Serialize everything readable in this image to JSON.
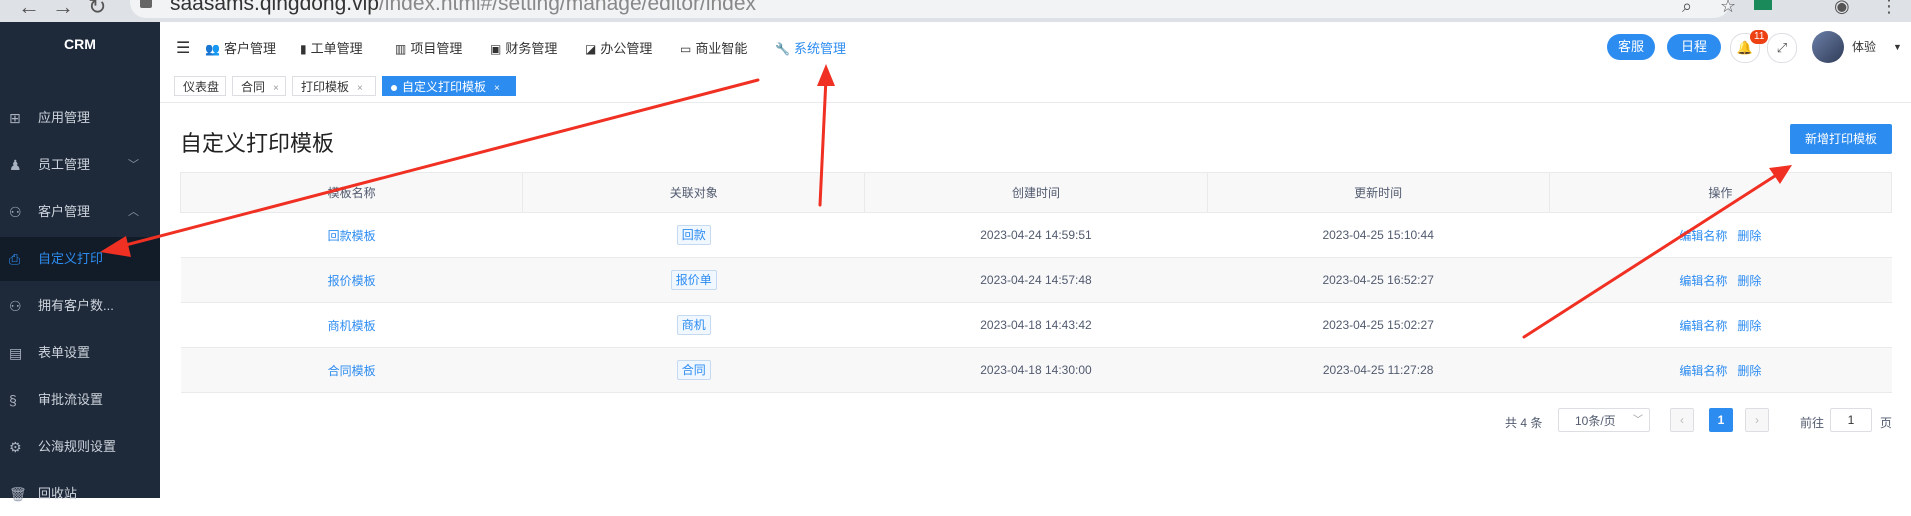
{
  "browser": {
    "url_host": "saasams.qingdong.vip",
    "url_path": "/index.html#/setting/manage/editor/index"
  },
  "sidebar": {
    "logo": "CRM",
    "items": [
      {
        "label": "应用管理",
        "icon": "apps-icon",
        "glyph": "⊞"
      },
      {
        "label": "员工管理",
        "icon": "user-icon",
        "glyph": "♟",
        "chevron": "﹀"
      },
      {
        "label": "客户管理",
        "icon": "customers-icon",
        "glyph": "⚇",
        "chevron": "︿"
      },
      {
        "label": "自定义打印",
        "icon": "print-icon",
        "glyph": "⎙",
        "active": true
      },
      {
        "label": "拥有客户数...",
        "icon": "group-icon",
        "glyph": "⚇"
      },
      {
        "label": "表单设置",
        "icon": "form-icon",
        "glyph": "▤"
      },
      {
        "label": "审批流设置",
        "icon": "flow-icon",
        "glyph": "§"
      },
      {
        "label": "公海规则设置",
        "icon": "rules-icon",
        "glyph": "⚙"
      },
      {
        "label": "回收站",
        "icon": "trash-icon",
        "glyph": "🗑"
      }
    ]
  },
  "topnav": {
    "items": [
      {
        "label": "客户管理",
        "icon": "customer-icon",
        "glyph": "👥"
      },
      {
        "label": "工单管理",
        "icon": "ticket-icon",
        "glyph": "▮"
      },
      {
        "label": "项目管理",
        "icon": "project-icon",
        "glyph": "▥"
      },
      {
        "label": "财务管理",
        "icon": "finance-icon",
        "glyph": "▣"
      },
      {
        "label": "办公管理",
        "icon": "office-icon",
        "glyph": "◪"
      },
      {
        "label": "商业智能",
        "icon": "bi-icon",
        "glyph": "▭"
      },
      {
        "label": "系统管理",
        "icon": "wrench-icon",
        "glyph": "🔧",
        "active": true
      }
    ],
    "service_label": "客服",
    "schedule_label": "日程",
    "notification_count": "11",
    "user_name": "体验"
  },
  "tabs": [
    {
      "label": "仪表盘"
    },
    {
      "label": "合同",
      "close": "×"
    },
    {
      "label": "打印模板",
      "close": "×"
    },
    {
      "label": "自定义打印模板",
      "close": "×",
      "active": true
    }
  ],
  "page": {
    "title": "自定义打印模板",
    "add_button": "新增打印模板"
  },
  "table": {
    "columns": [
      "模板名称",
      "关联对象",
      "创建时间",
      "更新时间",
      "操作"
    ],
    "rows": [
      {
        "name": "回款模板",
        "object": "回款",
        "created": "2023-04-24 14:59:51",
        "updated": "2023-04-25 15:10:44"
      },
      {
        "name": "报价模板",
        "object": "报价单",
        "created": "2023-04-24 14:57:48",
        "updated": "2023-04-25 16:52:27"
      },
      {
        "name": "商机模板",
        "object": "商机",
        "created": "2023-04-18 14:43:42",
        "updated": "2023-04-25 15:02:27"
      },
      {
        "name": "合同模板",
        "object": "合同",
        "created": "2023-04-18 14:30:00",
        "updated": "2023-04-25 11:27:28"
      }
    ],
    "op_edit": "编辑名称",
    "op_delete": "删除"
  },
  "pagination": {
    "total": "共 4 条",
    "page_size": "10条/页",
    "prev": "‹",
    "current": "1",
    "next": "›",
    "goto_label": "前往",
    "goto_value": "1",
    "page_label": "页"
  },
  "colors": {
    "primary": "#2d8cf0",
    "sidebar_bg": "#1e2a3a",
    "annotation_arrow": "#f03022"
  }
}
